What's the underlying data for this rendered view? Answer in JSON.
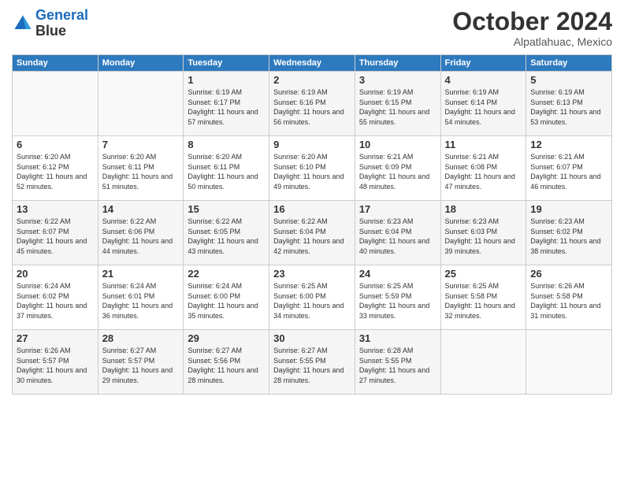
{
  "header": {
    "logo_line1": "General",
    "logo_line2": "Blue",
    "month_title": "October 2024",
    "location": "Alpatlahuac, Mexico"
  },
  "days_of_week": [
    "Sunday",
    "Monday",
    "Tuesday",
    "Wednesday",
    "Thursday",
    "Friday",
    "Saturday"
  ],
  "weeks": [
    [
      {
        "day": "",
        "sunrise": "",
        "sunset": "",
        "daylight": ""
      },
      {
        "day": "",
        "sunrise": "",
        "sunset": "",
        "daylight": ""
      },
      {
        "day": "1",
        "sunrise": "Sunrise: 6:19 AM",
        "sunset": "Sunset: 6:17 PM",
        "daylight": "Daylight: 11 hours and 57 minutes."
      },
      {
        "day": "2",
        "sunrise": "Sunrise: 6:19 AM",
        "sunset": "Sunset: 6:16 PM",
        "daylight": "Daylight: 11 hours and 56 minutes."
      },
      {
        "day": "3",
        "sunrise": "Sunrise: 6:19 AM",
        "sunset": "Sunset: 6:15 PM",
        "daylight": "Daylight: 11 hours and 55 minutes."
      },
      {
        "day": "4",
        "sunrise": "Sunrise: 6:19 AM",
        "sunset": "Sunset: 6:14 PM",
        "daylight": "Daylight: 11 hours and 54 minutes."
      },
      {
        "day": "5",
        "sunrise": "Sunrise: 6:19 AM",
        "sunset": "Sunset: 6:13 PM",
        "daylight": "Daylight: 11 hours and 53 minutes."
      }
    ],
    [
      {
        "day": "6",
        "sunrise": "Sunrise: 6:20 AM",
        "sunset": "Sunset: 6:12 PM",
        "daylight": "Daylight: 11 hours and 52 minutes."
      },
      {
        "day": "7",
        "sunrise": "Sunrise: 6:20 AM",
        "sunset": "Sunset: 6:11 PM",
        "daylight": "Daylight: 11 hours and 51 minutes."
      },
      {
        "day": "8",
        "sunrise": "Sunrise: 6:20 AM",
        "sunset": "Sunset: 6:11 PM",
        "daylight": "Daylight: 11 hours and 50 minutes."
      },
      {
        "day": "9",
        "sunrise": "Sunrise: 6:20 AM",
        "sunset": "Sunset: 6:10 PM",
        "daylight": "Daylight: 11 hours and 49 minutes."
      },
      {
        "day": "10",
        "sunrise": "Sunrise: 6:21 AM",
        "sunset": "Sunset: 6:09 PM",
        "daylight": "Daylight: 11 hours and 48 minutes."
      },
      {
        "day": "11",
        "sunrise": "Sunrise: 6:21 AM",
        "sunset": "Sunset: 6:08 PM",
        "daylight": "Daylight: 11 hours and 47 minutes."
      },
      {
        "day": "12",
        "sunrise": "Sunrise: 6:21 AM",
        "sunset": "Sunset: 6:07 PM",
        "daylight": "Daylight: 11 hours and 46 minutes."
      }
    ],
    [
      {
        "day": "13",
        "sunrise": "Sunrise: 6:22 AM",
        "sunset": "Sunset: 6:07 PM",
        "daylight": "Daylight: 11 hours and 45 minutes."
      },
      {
        "day": "14",
        "sunrise": "Sunrise: 6:22 AM",
        "sunset": "Sunset: 6:06 PM",
        "daylight": "Daylight: 11 hours and 44 minutes."
      },
      {
        "day": "15",
        "sunrise": "Sunrise: 6:22 AM",
        "sunset": "Sunset: 6:05 PM",
        "daylight": "Daylight: 11 hours and 43 minutes."
      },
      {
        "day": "16",
        "sunrise": "Sunrise: 6:22 AM",
        "sunset": "Sunset: 6:04 PM",
        "daylight": "Daylight: 11 hours and 42 minutes."
      },
      {
        "day": "17",
        "sunrise": "Sunrise: 6:23 AM",
        "sunset": "Sunset: 6:04 PM",
        "daylight": "Daylight: 11 hours and 40 minutes."
      },
      {
        "day": "18",
        "sunrise": "Sunrise: 6:23 AM",
        "sunset": "Sunset: 6:03 PM",
        "daylight": "Daylight: 11 hours and 39 minutes."
      },
      {
        "day": "19",
        "sunrise": "Sunrise: 6:23 AM",
        "sunset": "Sunset: 6:02 PM",
        "daylight": "Daylight: 11 hours and 38 minutes."
      }
    ],
    [
      {
        "day": "20",
        "sunrise": "Sunrise: 6:24 AM",
        "sunset": "Sunset: 6:02 PM",
        "daylight": "Daylight: 11 hours and 37 minutes."
      },
      {
        "day": "21",
        "sunrise": "Sunrise: 6:24 AM",
        "sunset": "Sunset: 6:01 PM",
        "daylight": "Daylight: 11 hours and 36 minutes."
      },
      {
        "day": "22",
        "sunrise": "Sunrise: 6:24 AM",
        "sunset": "Sunset: 6:00 PM",
        "daylight": "Daylight: 11 hours and 35 minutes."
      },
      {
        "day": "23",
        "sunrise": "Sunrise: 6:25 AM",
        "sunset": "Sunset: 6:00 PM",
        "daylight": "Daylight: 11 hours and 34 minutes."
      },
      {
        "day": "24",
        "sunrise": "Sunrise: 6:25 AM",
        "sunset": "Sunset: 5:59 PM",
        "daylight": "Daylight: 11 hours and 33 minutes."
      },
      {
        "day": "25",
        "sunrise": "Sunrise: 6:25 AM",
        "sunset": "Sunset: 5:58 PM",
        "daylight": "Daylight: 11 hours and 32 minutes."
      },
      {
        "day": "26",
        "sunrise": "Sunrise: 6:26 AM",
        "sunset": "Sunset: 5:58 PM",
        "daylight": "Daylight: 11 hours and 31 minutes."
      }
    ],
    [
      {
        "day": "27",
        "sunrise": "Sunrise: 6:26 AM",
        "sunset": "Sunset: 5:57 PM",
        "daylight": "Daylight: 11 hours and 30 minutes."
      },
      {
        "day": "28",
        "sunrise": "Sunrise: 6:27 AM",
        "sunset": "Sunset: 5:57 PM",
        "daylight": "Daylight: 11 hours and 29 minutes."
      },
      {
        "day": "29",
        "sunrise": "Sunrise: 6:27 AM",
        "sunset": "Sunset: 5:56 PM",
        "daylight": "Daylight: 11 hours and 28 minutes."
      },
      {
        "day": "30",
        "sunrise": "Sunrise: 6:27 AM",
        "sunset": "Sunset: 5:55 PM",
        "daylight": "Daylight: 11 hours and 28 minutes."
      },
      {
        "day": "31",
        "sunrise": "Sunrise: 6:28 AM",
        "sunset": "Sunset: 5:55 PM",
        "daylight": "Daylight: 11 hours and 27 minutes."
      },
      {
        "day": "",
        "sunrise": "",
        "sunset": "",
        "daylight": ""
      },
      {
        "day": "",
        "sunrise": "",
        "sunset": "",
        "daylight": ""
      }
    ]
  ]
}
